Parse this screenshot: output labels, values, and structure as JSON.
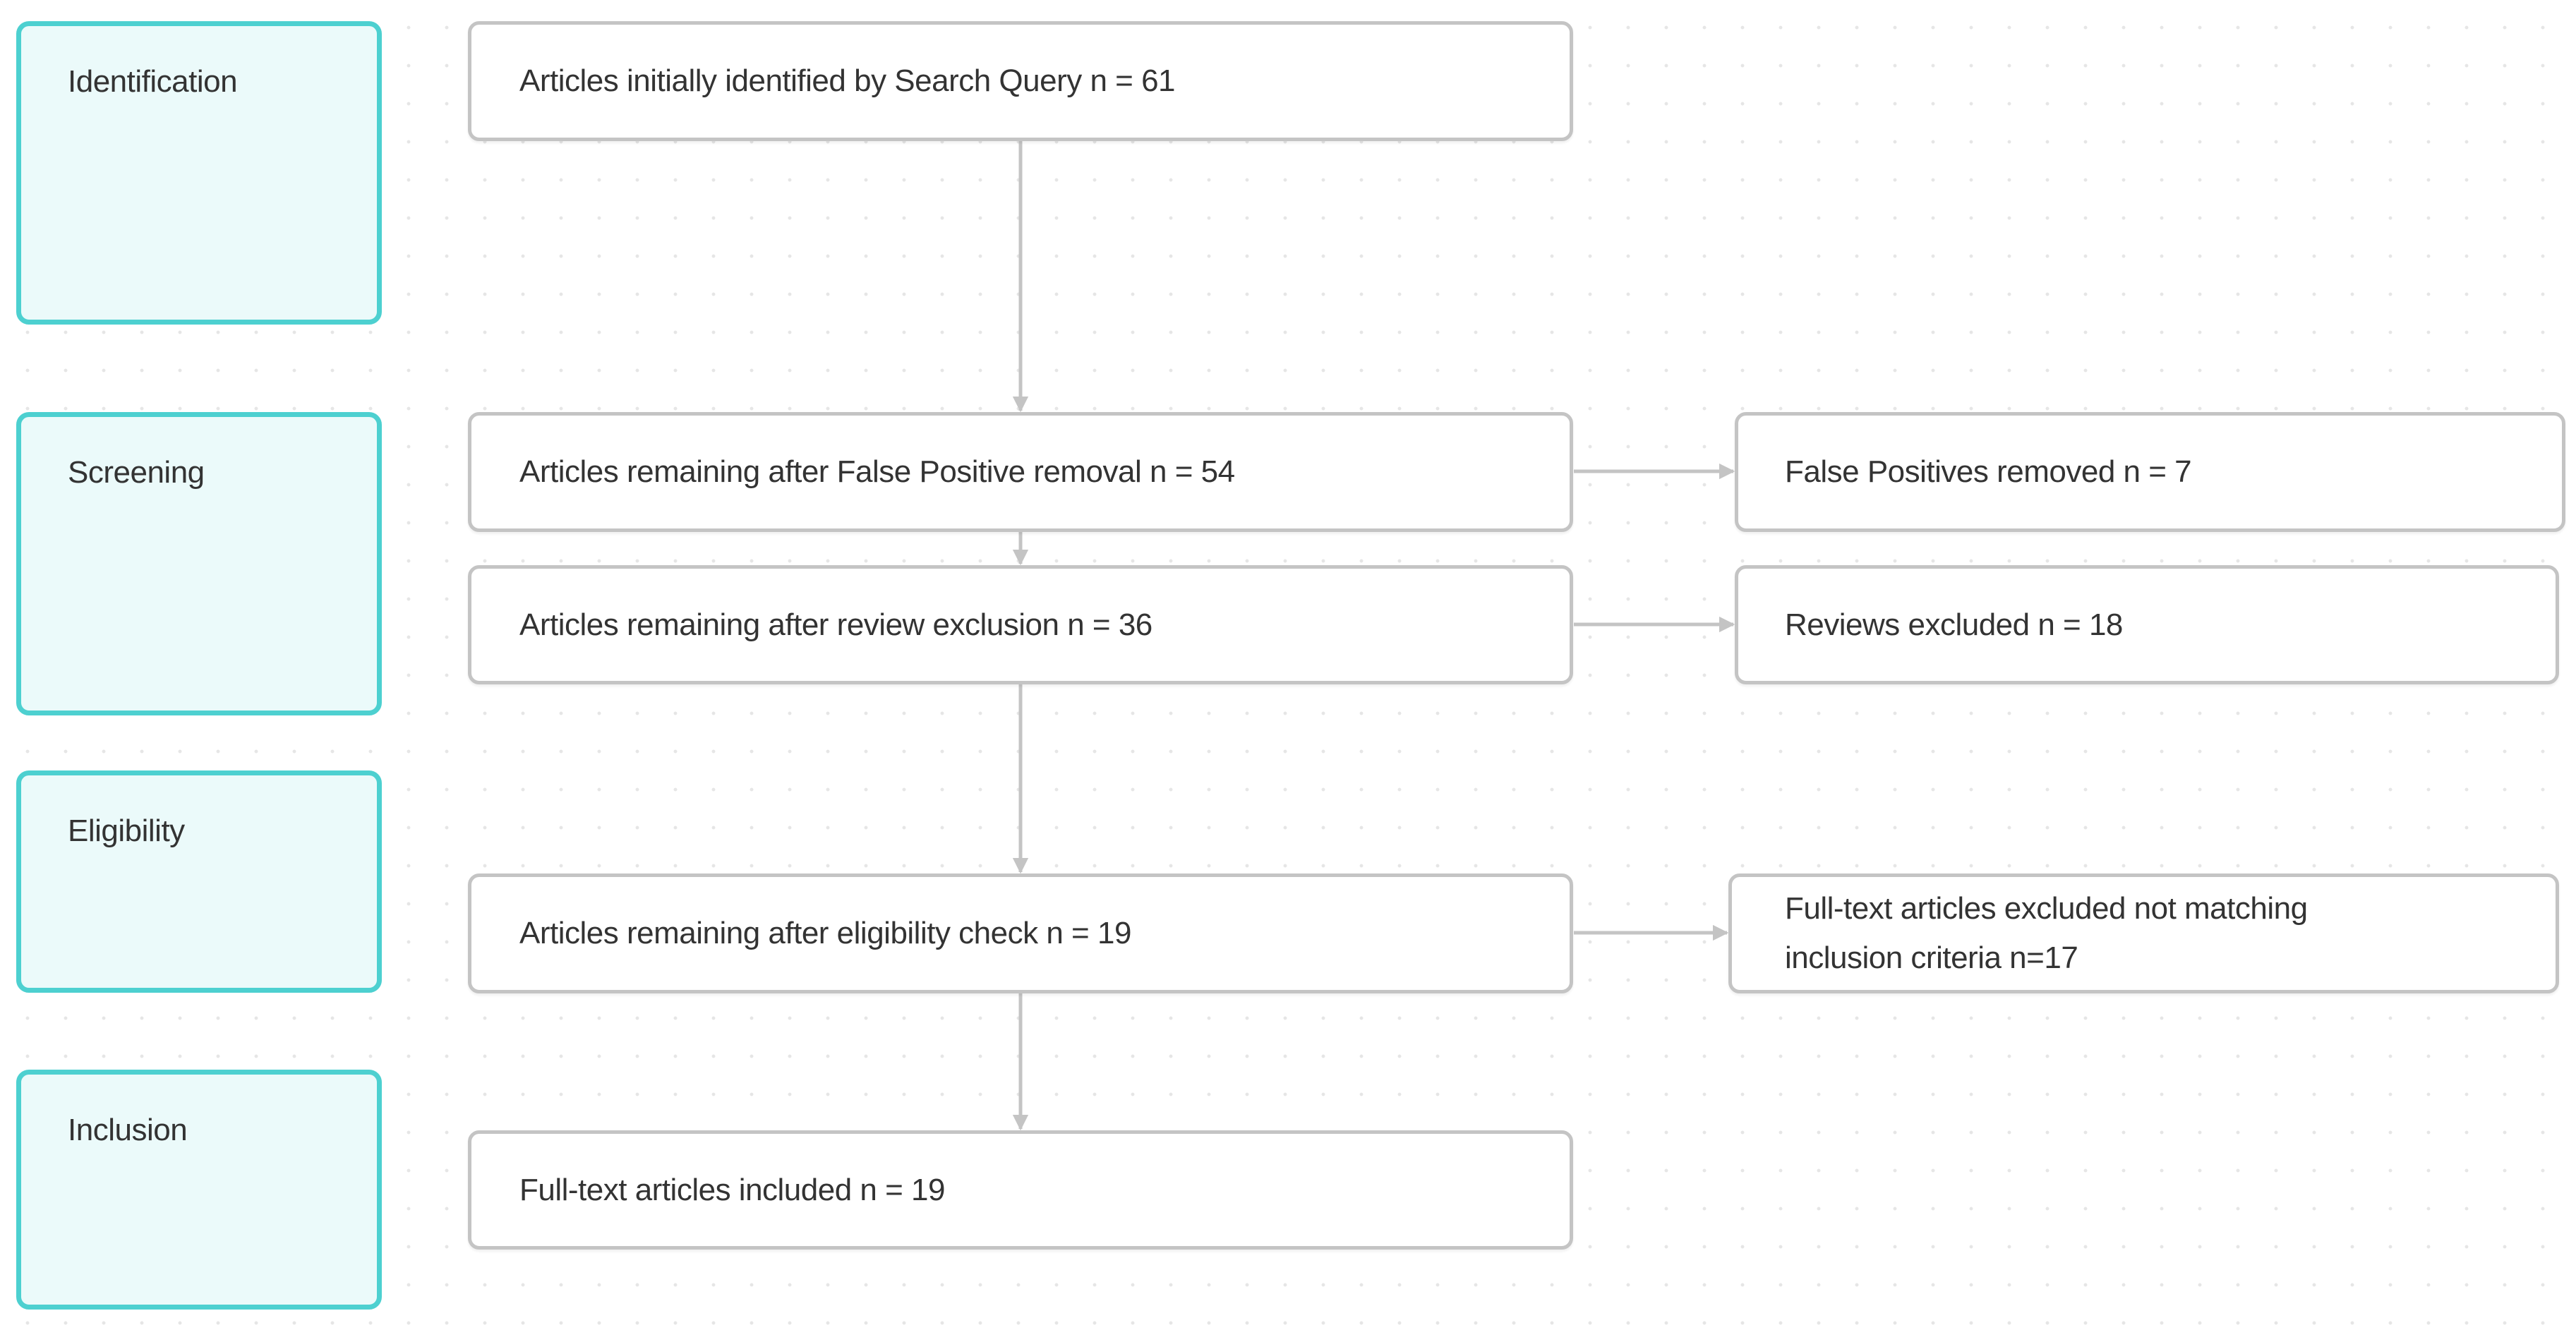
{
  "diagram": {
    "type": "PRISMA flow diagram",
    "colors": {
      "stage_border": "#4dd0d0",
      "stage_fill": "#ebfafa",
      "box_border": "#c4c4c4",
      "connector": "#c4c4c4",
      "text": "#333333"
    },
    "stages": [
      {
        "id": "identification",
        "label": "Identification"
      },
      {
        "id": "screening",
        "label": "Screening"
      },
      {
        "id": "eligibility",
        "label": "Eligibility"
      },
      {
        "id": "inclusion",
        "label": "Inclusion"
      }
    ],
    "main_flow": [
      {
        "id": "main-1",
        "stage": "identification",
        "text": "Articles initially identified by Search Query n = 61",
        "n": 61
      },
      {
        "id": "main-2",
        "stage": "screening",
        "text": "Articles remaining after False Positive removal n = 54",
        "n": 54
      },
      {
        "id": "main-3",
        "stage": "screening",
        "text": "Articles remaining after review exclusion n = 36",
        "n": 36
      },
      {
        "id": "main-4",
        "stage": "eligibility",
        "text": "Articles remaining after eligibility check n = 19",
        "n": 19
      },
      {
        "id": "main-5",
        "stage": "inclusion",
        "text": "Full-text articles included n = 19",
        "n": 19
      }
    ],
    "exclusions": [
      {
        "id": "right-1",
        "from": "main-2",
        "text": "False Positives removed n = 7",
        "n": 7
      },
      {
        "id": "right-2",
        "from": "main-3",
        "text": "Reviews excluded n = 18",
        "n": 18
      },
      {
        "id": "right-3",
        "from": "main-4",
        "text": "Full-text articles excluded not matching inclusion criteria n=17",
        "n": 17
      }
    ],
    "edges": [
      {
        "from": "main-1",
        "to": "main-2"
      },
      {
        "from": "main-2",
        "to": "main-3"
      },
      {
        "from": "main-3",
        "to": "main-4"
      },
      {
        "from": "main-4",
        "to": "main-5"
      },
      {
        "from": "main-2",
        "to": "right-1"
      },
      {
        "from": "main-3",
        "to": "right-2"
      },
      {
        "from": "main-4",
        "to": "right-3"
      }
    ]
  }
}
